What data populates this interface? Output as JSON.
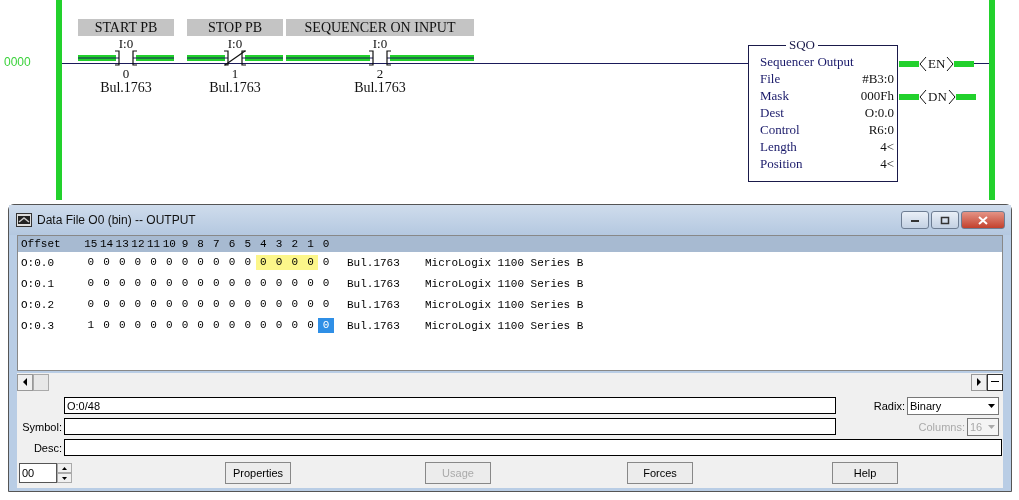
{
  "ladder": {
    "rung_number": "0000",
    "contacts": [
      {
        "label": "START PB",
        "address": "I:0",
        "bit": "0",
        "module": "Bul.1763",
        "kind": "xic",
        "energized": true
      },
      {
        "label": "STOP PB",
        "address": "I:0",
        "bit": "1",
        "module": "Bul.1763",
        "kind": "xio",
        "energized": true
      },
      {
        "label": "SEQUENCER ON INPUT",
        "address": "I:0",
        "bit": "2",
        "module": "Bul.1763",
        "kind": "xic",
        "energized": true
      }
    ],
    "instruction": {
      "mnemonic": "SQO",
      "title": "Sequencer Output",
      "params": [
        {
          "name": "File",
          "value": "#B3:0"
        },
        {
          "name": "Mask",
          "value": "000Fh"
        },
        {
          "name": "Dest",
          "value": "O:0.0"
        },
        {
          "name": "Control",
          "value": "R6:0"
        },
        {
          "name": "Length",
          "value": "4<"
        },
        {
          "name": "Position",
          "value": "4<"
        }
      ]
    },
    "outputs": [
      {
        "label": "EN",
        "energized": true
      },
      {
        "label": "DN",
        "energized": true
      }
    ]
  },
  "window": {
    "title": "Data File O0 (bin)  --  OUTPUT",
    "table": {
      "columns": [
        "Offset",
        "15",
        "14",
        "13",
        "12",
        "11",
        "10",
        "9",
        "8",
        "7",
        "6",
        "5",
        "4",
        "3",
        "2",
        "1",
        "0"
      ],
      "rows": [
        {
          "offset": "O:0.0",
          "module": "Bul.1763",
          "description": "MicroLogix 1100 Series B",
          "bits": [
            {
              "value": "0",
              "highlighted": false,
              "selected": false
            },
            {
              "value": "0",
              "highlighted": false,
              "selected": false
            },
            {
              "value": "0",
              "highlighted": false,
              "selected": false
            },
            {
              "value": "0",
              "highlighted": false,
              "selected": false
            },
            {
              "value": "0",
              "highlighted": false,
              "selected": false
            },
            {
              "value": "0",
              "highlighted": false,
              "selected": false
            },
            {
              "value": "0",
              "highlighted": false,
              "selected": false
            },
            {
              "value": "0",
              "highlighted": false,
              "selected": false
            },
            {
              "value": "0",
              "highlighted": false,
              "selected": false
            },
            {
              "value": "0",
              "highlighted": false,
              "selected": false
            },
            {
              "value": "0",
              "highlighted": false,
              "selected": false
            },
            {
              "value": "0",
              "highlighted": true,
              "selected": false
            },
            {
              "value": "0",
              "highlighted": true,
              "selected": false
            },
            {
              "value": "0",
              "highlighted": true,
              "selected": false
            },
            {
              "value": "0",
              "highlighted": true,
              "selected": false
            },
            {
              "value": "0",
              "highlighted": false,
              "selected": false
            }
          ]
        },
        {
          "offset": "O:0.1",
          "module": "Bul.1763",
          "description": "MicroLogix 1100 Series B",
          "bits": [
            {
              "value": "0",
              "highlighted": false,
              "selected": false
            },
            {
              "value": "0",
              "highlighted": false,
              "selected": false
            },
            {
              "value": "0",
              "highlighted": false,
              "selected": false
            },
            {
              "value": "0",
              "highlighted": false,
              "selected": false
            },
            {
              "value": "0",
              "highlighted": false,
              "selected": false
            },
            {
              "value": "0",
              "highlighted": false,
              "selected": false
            },
            {
              "value": "0",
              "highlighted": false,
              "selected": false
            },
            {
              "value": "0",
              "highlighted": false,
              "selected": false
            },
            {
              "value": "0",
              "highlighted": false,
              "selected": false
            },
            {
              "value": "0",
              "highlighted": false,
              "selected": false
            },
            {
              "value": "0",
              "highlighted": false,
              "selected": false
            },
            {
              "value": "0",
              "highlighted": false,
              "selected": false
            },
            {
              "value": "0",
              "highlighted": false,
              "selected": false
            },
            {
              "value": "0",
              "highlighted": false,
              "selected": false
            },
            {
              "value": "0",
              "highlighted": false,
              "selected": false
            },
            {
              "value": "0",
              "highlighted": false,
              "selected": false
            }
          ]
        },
        {
          "offset": "O:0.2",
          "module": "Bul.1763",
          "description": "MicroLogix 1100 Series B",
          "bits": [
            {
              "value": "0",
              "highlighted": false,
              "selected": false
            },
            {
              "value": "0",
              "highlighted": false,
              "selected": false
            },
            {
              "value": "0",
              "highlighted": false,
              "selected": false
            },
            {
              "value": "0",
              "highlighted": false,
              "selected": false
            },
            {
              "value": "0",
              "highlighted": false,
              "selected": false
            },
            {
              "value": "0",
              "highlighted": false,
              "selected": false
            },
            {
              "value": "0",
              "highlighted": false,
              "selected": false
            },
            {
              "value": "0",
              "highlighted": false,
              "selected": false
            },
            {
              "value": "0",
              "highlighted": false,
              "selected": false
            },
            {
              "value": "0",
              "highlighted": false,
              "selected": false
            },
            {
              "value": "0",
              "highlighted": false,
              "selected": false
            },
            {
              "value": "0",
              "highlighted": false,
              "selected": false
            },
            {
              "value": "0",
              "highlighted": false,
              "selected": false
            },
            {
              "value": "0",
              "highlighted": false,
              "selected": false
            },
            {
              "value": "0",
              "highlighted": false,
              "selected": false
            },
            {
              "value": "0",
              "highlighted": false,
              "selected": false
            }
          ]
        },
        {
          "offset": "O:0.3",
          "module": "Bul.1763",
          "description": "MicroLogix 1100 Series B",
          "bits": [
            {
              "value": "1",
              "highlighted": false,
              "selected": false
            },
            {
              "value": "0",
              "highlighted": false,
              "selected": false
            },
            {
              "value": "0",
              "highlighted": false,
              "selected": false
            },
            {
              "value": "0",
              "highlighted": false,
              "selected": false
            },
            {
              "value": "0",
              "highlighted": false,
              "selected": false
            },
            {
              "value": "0",
              "highlighted": false,
              "selected": false
            },
            {
              "value": "0",
              "highlighted": false,
              "selected": false
            },
            {
              "value": "0",
              "highlighted": false,
              "selected": false
            },
            {
              "value": "0",
              "highlighted": false,
              "selected": false
            },
            {
              "value": "0",
              "highlighted": false,
              "selected": false
            },
            {
              "value": "0",
              "highlighted": false,
              "selected": false
            },
            {
              "value": "0",
              "highlighted": false,
              "selected": false
            },
            {
              "value": "0",
              "highlighted": false,
              "selected": false
            },
            {
              "value": "0",
              "highlighted": false,
              "selected": false
            },
            {
              "value": "0",
              "highlighted": false,
              "selected": false
            },
            {
              "value": "0",
              "highlighted": false,
              "selected": true
            }
          ]
        }
      ]
    },
    "address": {
      "value": "O:0/48"
    },
    "symbol": {
      "label": "Symbol:"
    },
    "desc": {
      "label": "Desc:"
    },
    "radix": {
      "label": "Radix:",
      "value": "Binary",
      "disabled": false
    },
    "columns": {
      "label": "Columns:",
      "value": "16",
      "disabled": true
    },
    "spinner": {
      "value": "00"
    },
    "buttons": [
      {
        "label": "Properties",
        "disabled": false
      },
      {
        "label": "Usage",
        "disabled": true
      },
      {
        "label": "Forces",
        "disabled": false
      },
      {
        "label": "Help",
        "disabled": false
      }
    ]
  }
}
